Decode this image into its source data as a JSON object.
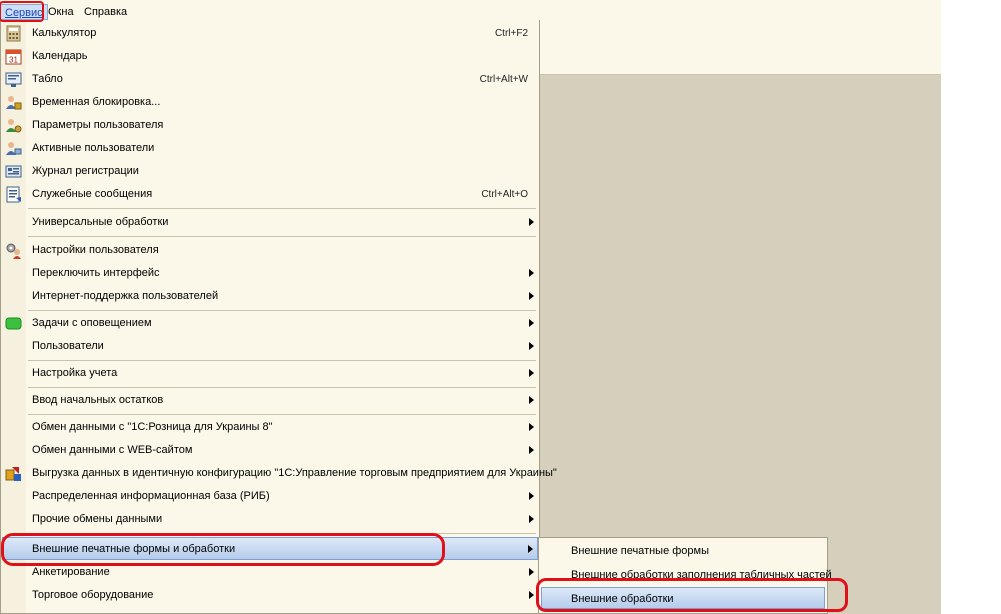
{
  "menubar": {
    "service": "Сервис",
    "windows": "Окна",
    "help": "Справка"
  },
  "menu": {
    "items": [
      {
        "label": "Калькулятор",
        "shortcut": "Ctrl+F2",
        "icon": "calculator-icon"
      },
      {
        "label": "Календарь",
        "shortcut": "",
        "icon": "calendar-icon"
      },
      {
        "label": "Табло",
        "shortcut": "Ctrl+Alt+W",
        "icon": "display-board-icon"
      },
      {
        "label": "Временная блокировка...",
        "shortcut": "",
        "icon": "user-lock-icon"
      },
      {
        "label": "Параметры пользователя",
        "shortcut": "",
        "icon": "user-settings-icon"
      },
      {
        "label": "Активные пользователи",
        "shortcut": "",
        "icon": "active-users-icon"
      },
      {
        "label": "Журнал регистрации",
        "shortcut": "",
        "icon": "event-log-icon"
      },
      {
        "label": "Служебные сообщения",
        "shortcut": "Ctrl+Alt+O",
        "icon": "service-messages-icon"
      },
      {
        "label": "Универсальные обработки",
        "shortcut": "",
        "icon": ""
      },
      {
        "label": "Настройки пользователя",
        "shortcut": "",
        "icon": "user-preferences-icon"
      },
      {
        "label": "Переключить интерфейс",
        "shortcut": "",
        "icon": ""
      },
      {
        "label": "Интернет-поддержка пользователей",
        "shortcut": "",
        "icon": ""
      },
      {
        "label": "Задачи с оповещением",
        "shortcut": "",
        "icon": "green-task-icon"
      },
      {
        "label": "Пользователи",
        "shortcut": "",
        "icon": ""
      },
      {
        "label": "Настройка учета",
        "shortcut": "",
        "icon": ""
      },
      {
        "label": "Ввод начальных остатков",
        "shortcut": "",
        "icon": ""
      },
      {
        "label": "Обмен данными с \"1С:Розница для Украины 8\"",
        "shortcut": "",
        "icon": ""
      },
      {
        "label": "Обмен данными с WEB-сайтом",
        "shortcut": "",
        "icon": ""
      },
      {
        "label": "Выгрузка данных в идентичную конфигурацию \"1С:Управление торговым предприятием для Украины\"",
        "shortcut": "",
        "icon": "data-export-icon"
      },
      {
        "label": "Распределенная информационная база (РИБ)",
        "shortcut": "",
        "icon": ""
      },
      {
        "label": "Прочие обмены данными",
        "shortcut": "",
        "icon": ""
      },
      {
        "label": "Внешние печатные формы и обработки",
        "shortcut": "",
        "icon": ""
      },
      {
        "label": "Анкетирование",
        "shortcut": "",
        "icon": ""
      },
      {
        "label": "Торговое оборудование",
        "shortcut": "",
        "icon": ""
      }
    ]
  },
  "submenu": {
    "items": [
      {
        "label": "Внешние печатные формы"
      },
      {
        "label": "Внешние обработки заполнения табличных частей"
      },
      {
        "label": "Внешние обработки"
      }
    ]
  },
  "colors": {
    "highlight": "#b5ccec",
    "menu_bg": "#fbf8ea",
    "workspace": "#d5cfbb",
    "annotation_red": "#e0101a"
  }
}
